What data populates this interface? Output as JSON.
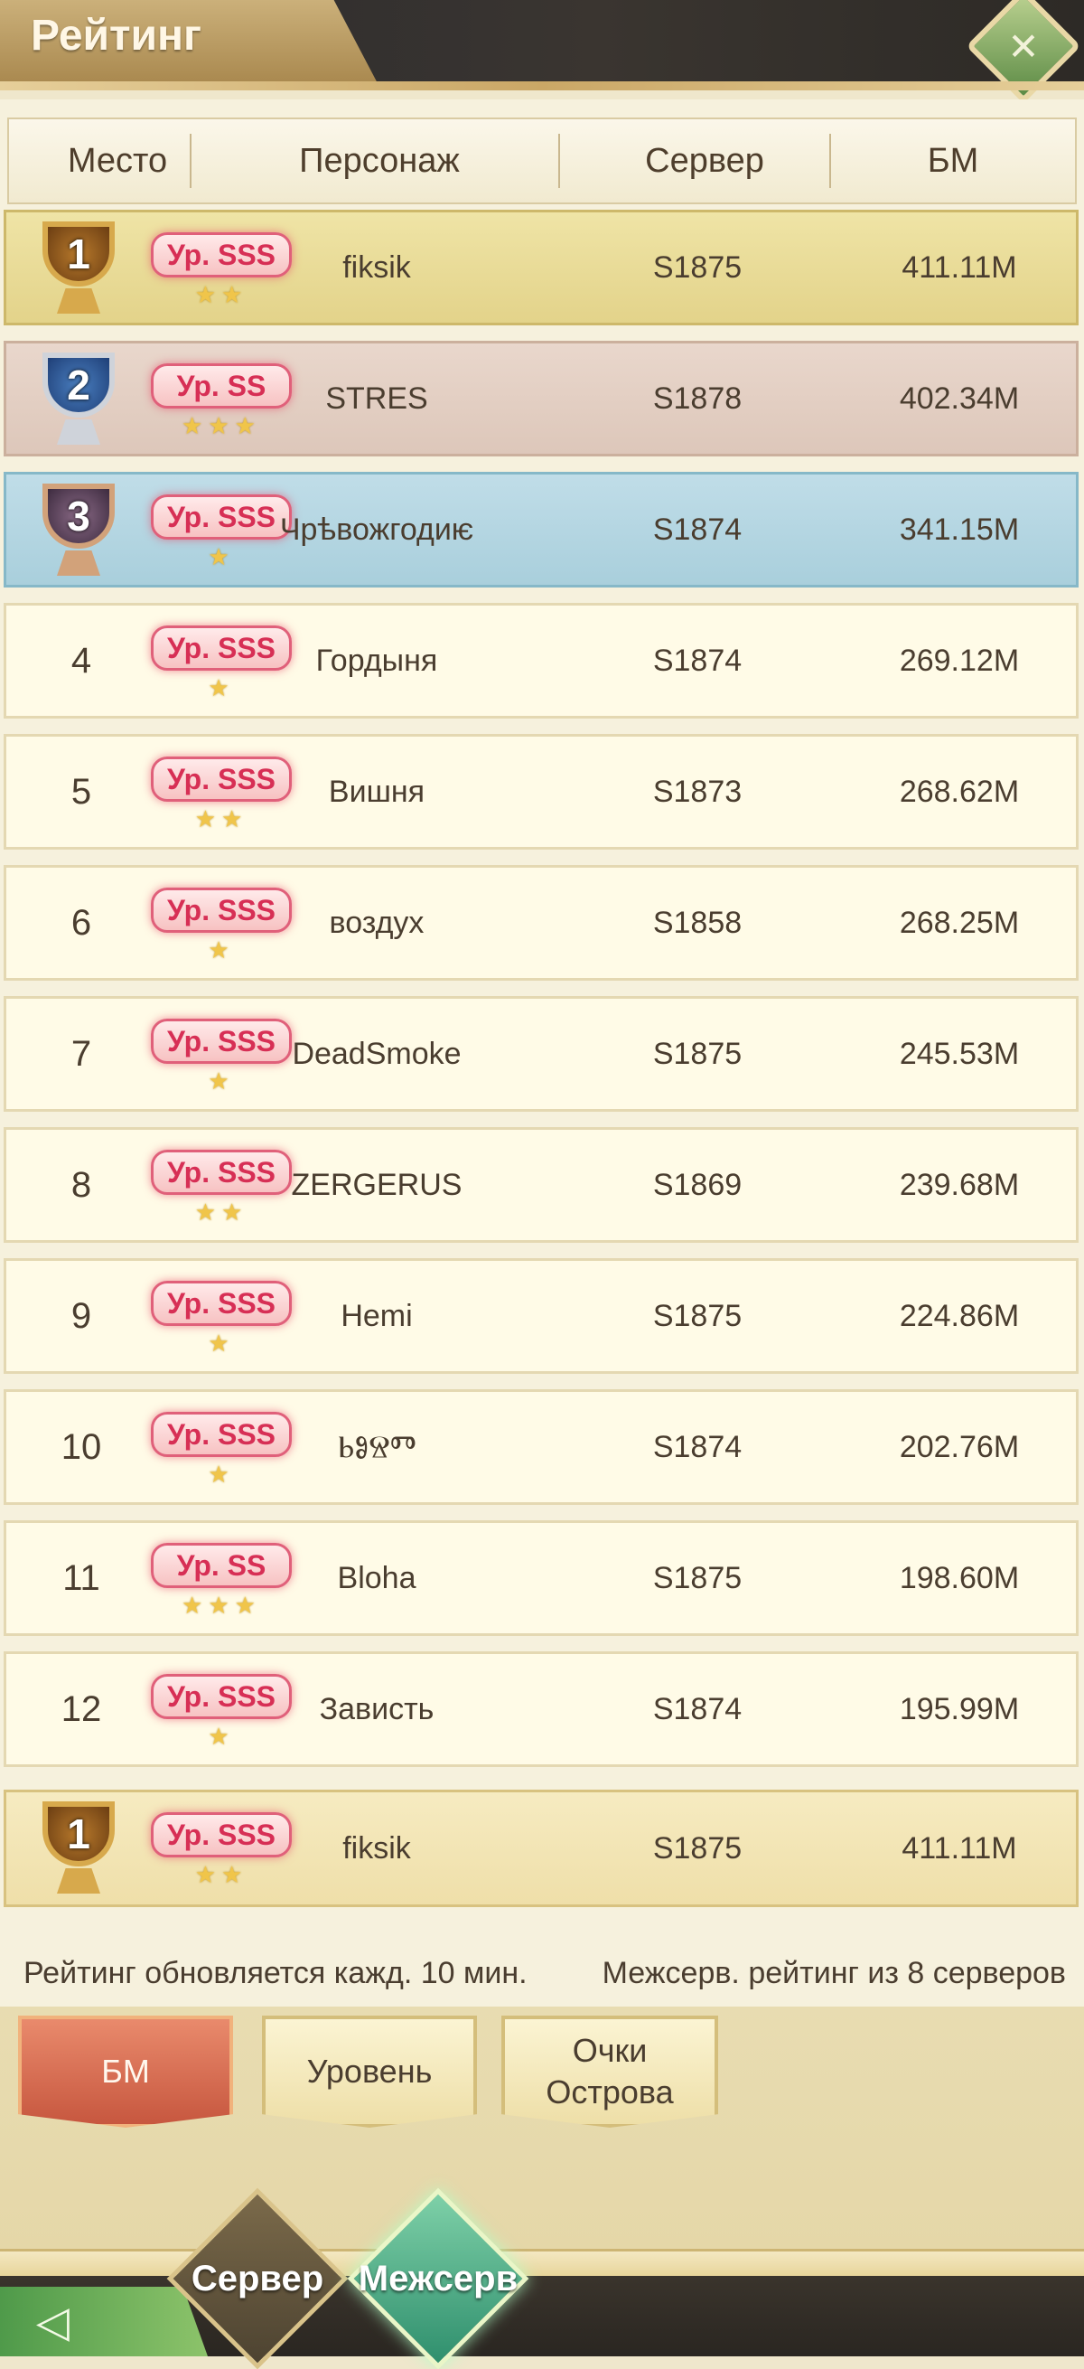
{
  "header": {
    "title": "Рейтинг"
  },
  "columns": {
    "place": "Место",
    "character": "Персонаж",
    "server": "Сервер",
    "bm": "БМ"
  },
  "rankings": [
    {
      "place": "1",
      "level": "Ур. SSS",
      "stars": "★★",
      "name": "fiksik",
      "server": "S1875",
      "bm": "411.11M"
    },
    {
      "place": "2",
      "level": "Ур. SS",
      "stars": "★★★",
      "name": "STRES",
      "server": "S1878",
      "bm": "402.34M"
    },
    {
      "place": "3",
      "level": "Ур. SSS",
      "stars": "★",
      "name": "Чрѣвожгодиѥ",
      "server": "S1874",
      "bm": "341.15M"
    },
    {
      "place": "4",
      "level": "Ур. SSS",
      "stars": "★",
      "name": "Гордыня",
      "server": "S1874",
      "bm": "269.12M"
    },
    {
      "place": "5",
      "level": "Ур. SSS",
      "stars": "★★",
      "name": "Вишня",
      "server": "S1873",
      "bm": "268.62M"
    },
    {
      "place": "6",
      "level": "Ур. SSS",
      "stars": "★",
      "name": "воздух",
      "server": "S1858",
      "bm": "268.25M"
    },
    {
      "place": "7",
      "level": "Ур. SSS",
      "stars": "★",
      "name": "DeadSmoke",
      "server": "S1875",
      "bm": "245.53M"
    },
    {
      "place": "8",
      "level": "Ур. SSS",
      "stars": "★★",
      "name": "ZERGERUS",
      "server": "S1869",
      "bm": "239.68M"
    },
    {
      "place": "9",
      "level": "Ур. SSS",
      "stars": "★",
      "name": "Hemi",
      "server": "S1875",
      "bm": "224.86M"
    },
    {
      "place": "10",
      "level": "Ур. SSS",
      "stars": "★",
      "name": "ⰓⰑⰔⰕ",
      "server": "S1874",
      "bm": "202.76M"
    },
    {
      "place": "11",
      "level": "Ур. SS",
      "stars": "★★★",
      "name": "Bloha",
      "server": "S1875",
      "bm": "198.60M"
    },
    {
      "place": "12",
      "level": "Ур. SSS",
      "stars": "★",
      "name": "Зависть",
      "server": "S1874",
      "bm": "195.99M"
    }
  ],
  "my_rank": {
    "place": "1",
    "level": "Ур. SSS",
    "stars": "★★",
    "name": "fiksik",
    "server": "S1875",
    "bm": "411.11M"
  },
  "footer": {
    "update_note": "Рейтинг обновляется кажд. 10 мин.",
    "cross_server_note": "Межсерв. рейтинг из 8 серверов"
  },
  "sort_tabs": [
    {
      "label": "БМ",
      "active": true
    },
    {
      "label": "Уровень",
      "active": false
    },
    {
      "label": "Очки Острова",
      "active": false
    }
  ],
  "scope_tabs": [
    {
      "label": "Сервер",
      "active": false
    },
    {
      "label": "Межсерв",
      "active": true
    }
  ],
  "colors": {
    "accent_tab": "#c7573f",
    "level_badge": "#d72f55",
    "star": "#f0c54a"
  }
}
